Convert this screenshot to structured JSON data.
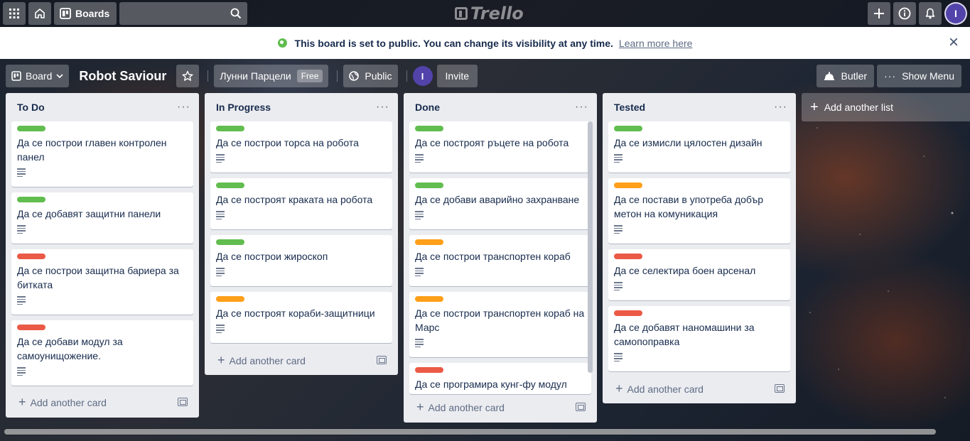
{
  "colors": {
    "green": "#61bd4f",
    "orange": "#ff9f1a",
    "red": "#eb5a46",
    "avatar": "#5243aa"
  },
  "topbar": {
    "apps_icon": "grid-icon",
    "home_icon": "house-icon",
    "boards_label": "Boards",
    "search_icon": "magnifier-icon",
    "logo_text": "Trello",
    "create_icon": "plus-icon",
    "info_icon": "info-icon",
    "notifications_icon": "bell-icon",
    "avatar_initial": "I"
  },
  "notice": {
    "message": "This board is set to public. You can change its visibility at any time.",
    "link": "Learn more here",
    "close": "×"
  },
  "board_header": {
    "board_menu_label": "Board",
    "title": "Robot Saviour",
    "workspace": "Лунни Парцели",
    "workspace_badge": "Free",
    "visibility": "Public",
    "member_initial": "I",
    "invite": "Invite",
    "butler": "Butler",
    "show_menu": "Show Menu"
  },
  "add_list_label": "Add another list",
  "add_card_label": "Add another card",
  "lists": [
    {
      "title": "To Do",
      "cards": [
        {
          "label": "green",
          "text": "Да се построи главен контролен панел"
        },
        {
          "label": "green",
          "text": "Да се добавят защитни панели"
        },
        {
          "label": "red",
          "text": "Да се построи защитна бариера за битката"
        },
        {
          "label": "red",
          "text": "Да се добави модул за самоунищожение."
        }
      ]
    },
    {
      "title": "In Progress",
      "cards": [
        {
          "label": "green",
          "text": "Да се построи торса на робота"
        },
        {
          "label": "green",
          "text": "Да се построят краката на робота"
        },
        {
          "label": "green",
          "text": "Да се построи жироскоп"
        },
        {
          "label": "orange",
          "text": "Да се построят кораби-защитници"
        }
      ]
    },
    {
      "title": "Done",
      "cards": [
        {
          "label": "green",
          "text": "Да се построят ръцете на робота"
        },
        {
          "label": "green",
          "text": "Да се добави аварийно захранване"
        },
        {
          "label": "orange",
          "text": "Да се построи транспортен кораб"
        },
        {
          "label": "orange",
          "text": "Да се построи транспортен кораб на Марс"
        },
        {
          "label": "red",
          "text": "Да се програмира кунг-фу модул"
        }
      ]
    },
    {
      "title": "Tested",
      "cards": [
        {
          "label": "green",
          "text": "Да се измисли цялостен дизайн"
        },
        {
          "label": "orange",
          "text": "Да се постави в употреба добър метон на комуникация"
        },
        {
          "label": "red",
          "text": "Да се селектира боен арсенал"
        },
        {
          "label": "red",
          "text": "Да се добавят наномашини за самопоправка"
        }
      ]
    }
  ]
}
